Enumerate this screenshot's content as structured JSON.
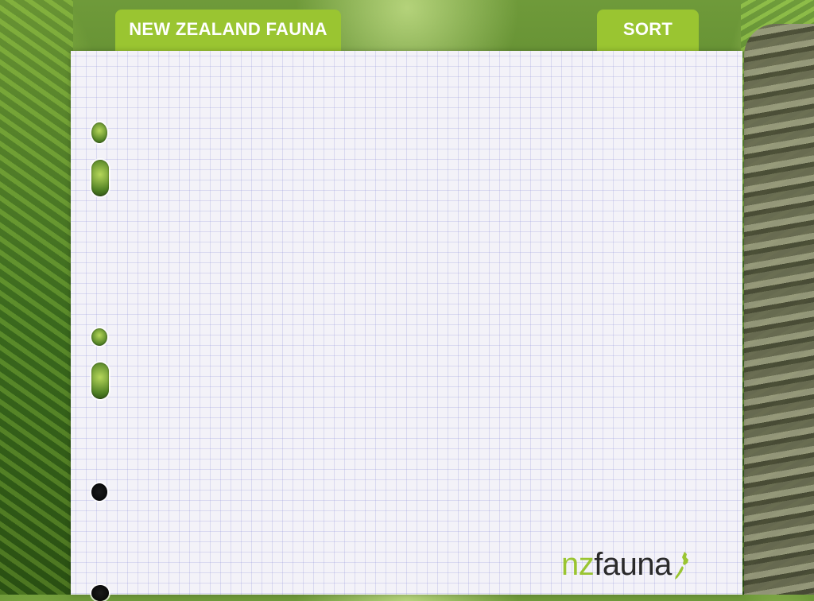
{
  "header": {
    "title_tab": "NEW ZEALAND FAUNA",
    "sort_tab": "SORT"
  },
  "branding": {
    "logo_prefix": "nz",
    "logo_suffix": "fauna",
    "accent_color": "#9ac531"
  },
  "background": {
    "description_icon": "rainforest-photo"
  }
}
